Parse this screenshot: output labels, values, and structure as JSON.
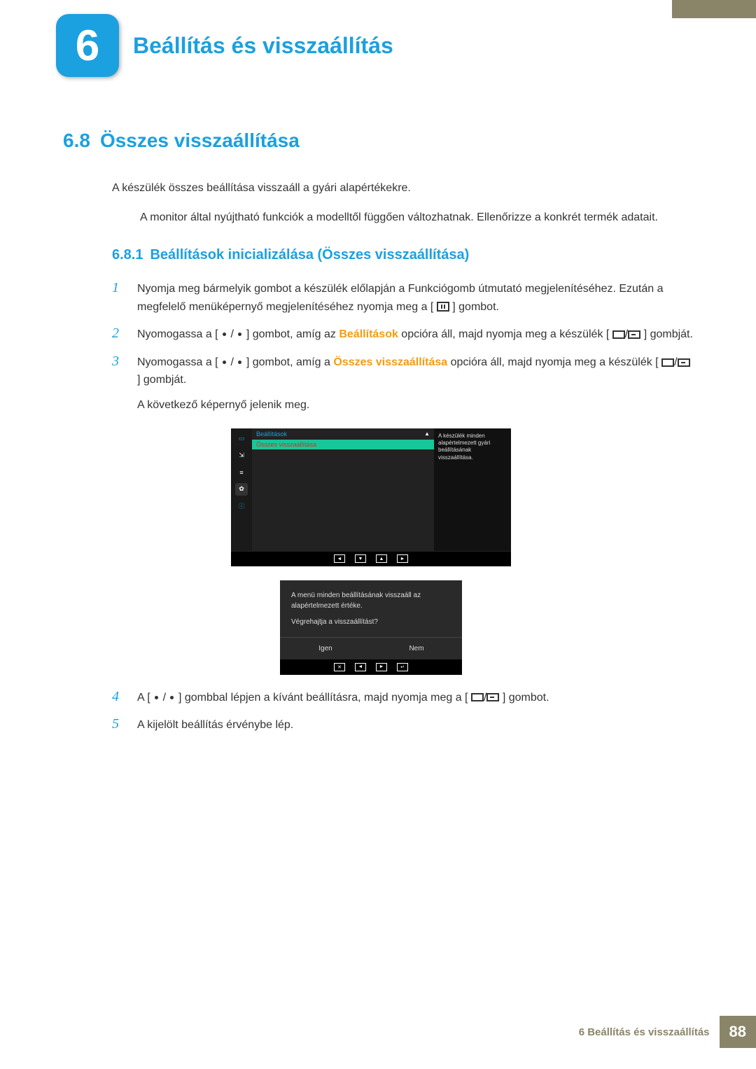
{
  "chapter": {
    "number": "6",
    "title": "Beállítás és visszaállítás"
  },
  "section": {
    "number": "6.8",
    "title": "Összes visszaállítása",
    "intro": "A készülék összes beállítása visszaáll a gyári alapértékekre.",
    "note": "A monitor által nyújtható funkciók a modelltől függően változhatnak. Ellenőrizze a konkrét termék adatait."
  },
  "subsection": {
    "number": "6.8.1",
    "title": "Beállítások inicializálása (Összes visszaállítása)"
  },
  "steps": {
    "s1": "Nyomja meg bármelyik gombot a készülék előlapján a Funkciógomb útmutató megjelenítéséhez. Ezután a megfelelő menüképernyő megjelenítéséhez nyomja meg a [",
    "s1b": "] gombot.",
    "s2a": "Nyomogassa a [",
    "s2b": "] gombot, amíg az ",
    "s2kw": "Beállítások",
    "s2c": " opcióra áll, majd nyomja meg a készülék [",
    "s2d": "] gombját.",
    "s3a": "Nyomogassa a [",
    "s3b": "] gombot, amíg a ",
    "s3kw": "Összes visszaállítása",
    "s3c": " opcióra áll, majd nyomja meg a készülék [",
    "s3d": "] gombját.",
    "s3e": "A következő képernyő jelenik meg.",
    "s4a": "A [",
    "s4b": "] gombbal lépjen a kívánt beállításra, majd nyomja meg a [",
    "s4c": "] gombot.",
    "s5": "A kijelölt beállítás érvénybe lép."
  },
  "osd1": {
    "title": "Beállítások",
    "selected": "Összes visszaállítása",
    "help": "A készülék minden alapértelmezett gyári beállításának visszaállítása.",
    "nav": [
      "◄",
      "▼",
      "▲",
      "►"
    ]
  },
  "osd2": {
    "line1": "A menü minden beállításának visszaáll az alapértelmezett értéke.",
    "line2": "Végrehajtja a visszaállítást?",
    "yes": "Igen",
    "no": "Nem",
    "nav": [
      "✕",
      "◄",
      "►",
      "↵"
    ]
  },
  "footer": {
    "text": "6 Beállítás és visszaállítás",
    "page": "88"
  }
}
